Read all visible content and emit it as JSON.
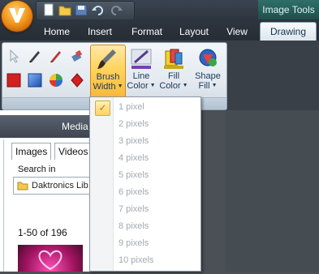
{
  "titlebar": {
    "contextual_header": "Image Tools"
  },
  "tabs": [
    {
      "label": "Home"
    },
    {
      "label": "Insert"
    },
    {
      "label": "Format"
    },
    {
      "label": "Layout"
    },
    {
      "label": "View"
    },
    {
      "label": "Drawing"
    }
  ],
  "ribbon": {
    "buttons": {
      "brush_width": {
        "line1": "Brush",
        "line2": "Width"
      },
      "line_color": {
        "line1": "Line",
        "line2": "Color"
      },
      "fill_color": {
        "line1": "Fill",
        "line2": "Color"
      },
      "shape_fill": {
        "line1": "Shape",
        "line2": "Fill"
      }
    },
    "icons": {
      "small_row1": [
        "pointer-icon",
        "pen-icon",
        "pencil-icon",
        "eraser-icon"
      ],
      "small_row2": [
        "red-square-icon",
        "blue-gradient-icon",
        "color-wheel-icon",
        "red-diamond-icon"
      ]
    }
  },
  "brush_width_menu": {
    "selected_index": 0,
    "items": [
      "1 pixel",
      "2 pixels",
      "3 pixels",
      "4 pixels",
      "5 pixels",
      "6 pixels",
      "7 pixels",
      "8 pixels",
      "9 pixels",
      "10 pixels"
    ]
  },
  "media_panel": {
    "title": "Media",
    "tabs": [
      "Images",
      "Videos"
    ],
    "search_in_label": "Search in",
    "search_in_value": "Daktronics Lib",
    "result_range": "1-50 of 196"
  },
  "colors": {
    "accent_orange": "#f39a1e",
    "active_button": "#ffd35c",
    "contextual_tab": "#2f6f6a"
  }
}
